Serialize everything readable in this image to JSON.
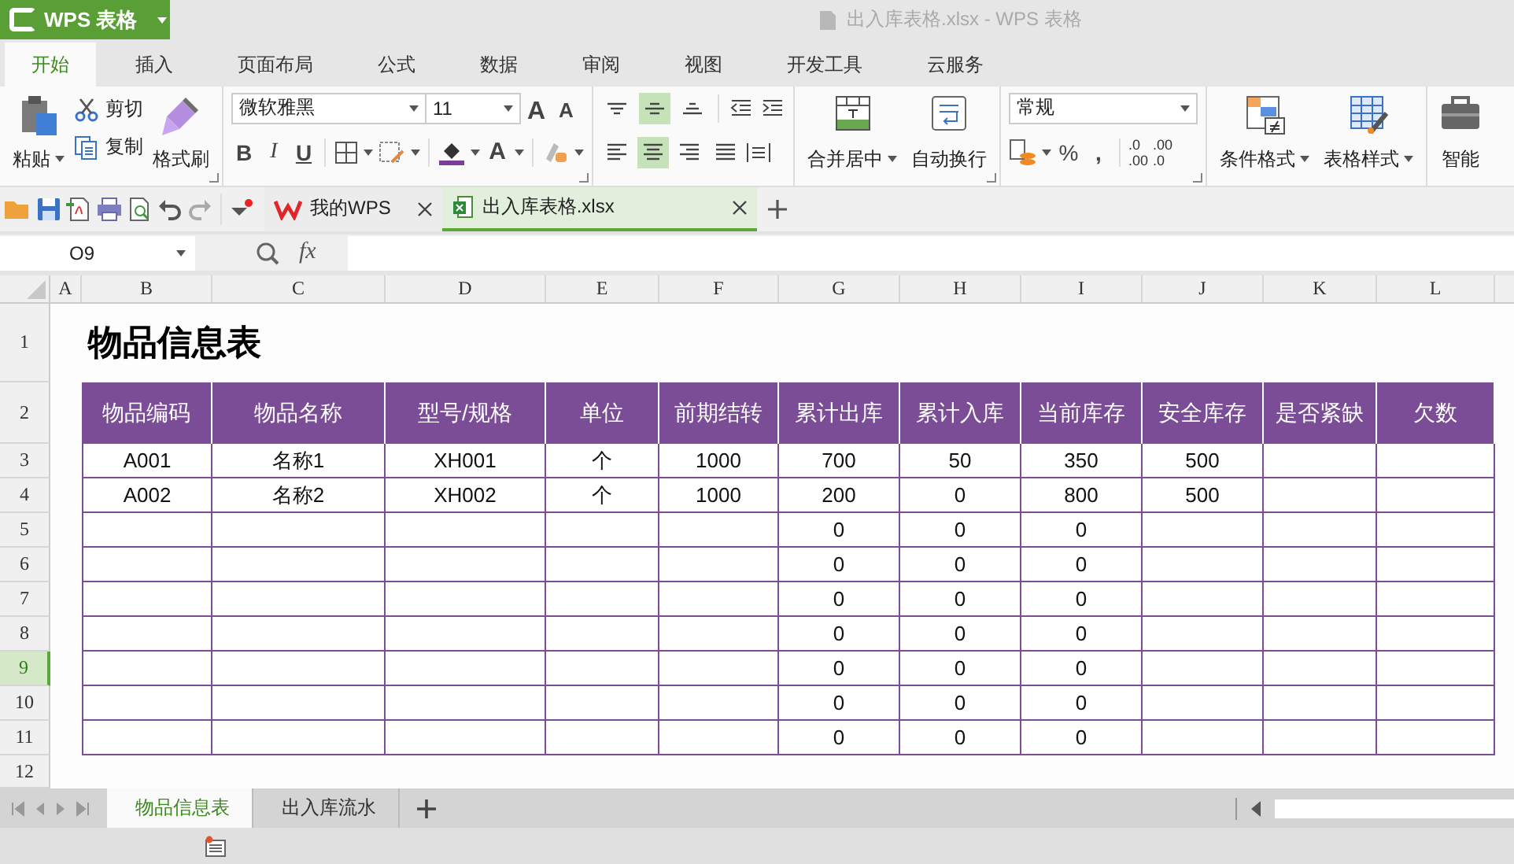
{
  "app": {
    "logo": "WPS 表格",
    "title": "出入库表格.xlsx - WPS 表格"
  },
  "menu_tabs": [
    {
      "label": "开始",
      "selected": true
    },
    {
      "label": "插入",
      "selected": false
    },
    {
      "label": "页面布局",
      "selected": false
    },
    {
      "label": "公式",
      "selected": false
    },
    {
      "label": "数据",
      "selected": false
    },
    {
      "label": "审阅",
      "selected": false
    },
    {
      "label": "视图",
      "selected": false
    },
    {
      "label": "开发工具",
      "selected": false
    },
    {
      "label": "云服务",
      "selected": false
    }
  ],
  "ribbon": {
    "paste": "粘贴",
    "cut": "剪切",
    "copy": "复制",
    "format_painter": "格式刷",
    "font_name": "微软雅黑",
    "font_size": "11",
    "font_size_buttons": [
      {
        "kind": "grow",
        "label": "A"
      },
      {
        "kind": "shrink",
        "label": "A"
      }
    ],
    "style_buttons": [
      "B",
      "I",
      "U"
    ],
    "font_color": "A",
    "vertical_align": [
      {
        "kind": "top",
        "selected": false
      },
      {
        "kind": "middle",
        "selected": true
      },
      {
        "kind": "bottom",
        "selected": false
      }
    ],
    "horizontal_align": [
      {
        "kind": "left",
        "selected": false
      },
      {
        "kind": "center",
        "selected": true
      },
      {
        "kind": "right",
        "selected": false
      },
      {
        "kind": "justify",
        "selected": false
      }
    ],
    "merge": "合并居中",
    "wrap": "自动换行",
    "number_format": "常规",
    "percent": "%",
    "comma": ",",
    "decimal_buttons": [
      {
        "top": ".0",
        "bottom": ".00"
      },
      {
        "top": ".00",
        "bottom": ".0"
      }
    ],
    "conditional_format": "条件格式",
    "table_style": "表格样式",
    "smart_tools": "智能"
  },
  "doc_tabs": [
    {
      "label": "我的WPS",
      "selected": false
    },
    {
      "label": "出入库表格.xlsx",
      "selected": true
    }
  ],
  "formula_bar": {
    "cell_ref": "O9",
    "fx": "fx"
  },
  "sheet": {
    "columns": [
      "A",
      "B",
      "C",
      "D",
      "E",
      "F",
      "G",
      "H",
      "I",
      "J",
      "K",
      "L"
    ],
    "rows": [
      {
        "number": "1",
        "selected": false,
        "kind": "title",
        "title": "物品信息表"
      },
      {
        "number": "2",
        "selected": false,
        "kind": "header",
        "cells": [
          "物品编码",
          "物品名称",
          "型号/规格",
          "单位",
          "前期结转",
          "累计出库",
          "累计入库",
          "当前库存",
          "安全库存",
          "是否紧缺",
          "欠数"
        ]
      },
      {
        "number": "3",
        "selected": false,
        "kind": "data",
        "cells": {
          "B": "A001",
          "C": "名称1",
          "D": "XH001",
          "E": "个",
          "F": "1000",
          "G": "700",
          "H": "50",
          "I": "350",
          "J": "500"
        }
      },
      {
        "number": "4",
        "selected": false,
        "kind": "data",
        "cells": {
          "B": "A002",
          "C": "名称2",
          "D": "XH002",
          "E": "个",
          "F": "1000",
          "G": "200",
          "H": "0",
          "I": "800",
          "J": "500"
        }
      },
      {
        "number": "5",
        "selected": false,
        "kind": "data",
        "cells": {
          "G": "0",
          "H": "0",
          "I": "0"
        }
      },
      {
        "number": "6",
        "selected": false,
        "kind": "data",
        "cells": {
          "G": "0",
          "H": "0",
          "I": "0"
        }
      },
      {
        "number": "7",
        "selected": false,
        "kind": "data",
        "cells": {
          "G": "0",
          "H": "0",
          "I": "0"
        }
      },
      {
        "number": "8",
        "selected": false,
        "kind": "data",
        "cells": {
          "G": "0",
          "H": "0",
          "I": "0"
        }
      },
      {
        "number": "9",
        "selected": true,
        "kind": "data",
        "cells": {
          "G": "0",
          "H": "0",
          "I": "0"
        }
      },
      {
        "number": "10",
        "selected": false,
        "kind": "data",
        "cells": {
          "G": "0",
          "H": "0",
          "I": "0"
        }
      },
      {
        "number": "11",
        "selected": false,
        "kind": "data",
        "cells": {
          "G": "0",
          "H": "0",
          "I": "0"
        }
      },
      {
        "number": "12",
        "selected": false,
        "kind": "blank"
      }
    ]
  },
  "sheet_tabs": [
    {
      "label": "物品信息表",
      "selected": true
    },
    {
      "label": "出入库流水",
      "selected": false
    }
  ]
}
